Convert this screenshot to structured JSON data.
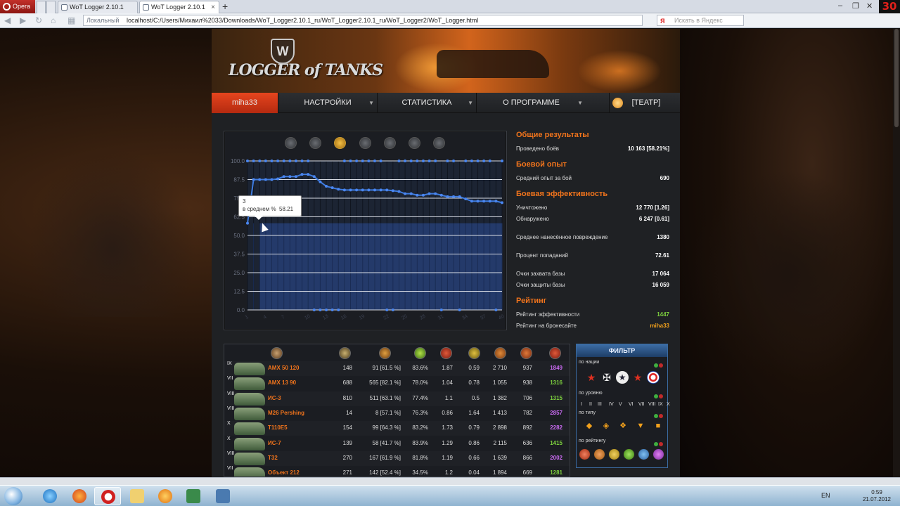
{
  "browser": {
    "menu_label": "Opera",
    "tabs": [
      {
        "label": "WoT Logger 2.10.1"
      },
      {
        "label": "WoT Logger 2.10.1"
      }
    ],
    "address_prefix": "Локальный",
    "address": "localhost/C:/Users/Михаил%2033/Downloads/WoT_Logger2.10.1_ru/WoT_Logger2.10.1_ru/WoT_Logger2/WoT_Logger.html",
    "search_placeholder": "Искать в Яндекс",
    "fps_badge": "30"
  },
  "app": {
    "logo_text": "LOGGER of TANKS",
    "logo_emblem": "W",
    "nav": [
      {
        "label": "miha33"
      },
      {
        "label": "НАСТРОЙКИ"
      },
      {
        "label": "СТАТИСТИКА"
      },
      {
        "label": "О ПРОГРАММЕ"
      },
      {
        "label": "[ТЕАТР]"
      }
    ]
  },
  "chart_data": {
    "type": "line",
    "ylim": [
      0,
      100
    ],
    "yticks": [
      "100.0",
      "87.5",
      "75.0",
      "62.5",
      "50.0",
      "37.5",
      "25.0",
      "12.5",
      "0.0"
    ],
    "xticks": [
      "1",
      "4",
      "7",
      "10",
      "13",
      "16",
      "19",
      "22",
      "25",
      "28",
      "31",
      "34",
      "37",
      "40"
    ],
    "series": [
      {
        "values": [
          58.2,
          87.5,
          87.5,
          87.5,
          87.5,
          88,
          89.5,
          89.5,
          89.5,
          91,
          91,
          89.5,
          86,
          83,
          82,
          81,
          80.5,
          80.5,
          80.5,
          80.5,
          80.5,
          80.5,
          80.5,
          80.5,
          80,
          79.5,
          78,
          78,
          77,
          77,
          78,
          78,
          77,
          76,
          76,
          76,
          74.5,
          73,
          73,
          73,
          73,
          73,
          72
        ]
      },
      {
        "values": [
          100,
          100,
          100,
          100,
          100,
          100,
          100,
          100,
          100,
          100,
          100,
          0,
          0,
          0,
          0,
          0,
          100,
          100,
          100,
          100,
          100,
          100,
          100,
          0,
          0,
          100,
          100,
          100,
          100,
          100,
          100,
          100,
          0,
          100,
          100,
          0,
          100,
          100,
          100,
          100,
          100,
          0,
          100
        ]
      }
    ],
    "tooltip": {
      "line1": "3",
      "label": "в среднем %",
      "value": "58.21"
    }
  },
  "stats": {
    "general": {
      "title": "Общие результаты",
      "rows": [
        {
          "label": "Проведено боёв",
          "value": "10 163 [58.21%]"
        }
      ]
    },
    "xp": {
      "title": "Боевой опыт",
      "rows": [
        {
          "label": "Средний опыт за бой",
          "value": "690"
        }
      ]
    },
    "efficiency": {
      "title": "Боевая эффективность",
      "rows": [
        {
          "label": "Уничтожено",
          "value": "12 770 [1.26]"
        },
        {
          "label": "Обнаружено",
          "value": "6 247 [0.61]"
        },
        {
          "label": "Среднее нанесённое повреждение",
          "value": "1380"
        },
        {
          "label": "Процент попаданий",
          "value": "72.61"
        },
        {
          "label": "Очки захвата базы",
          "value": "17 064"
        },
        {
          "label": "Очки защиты базы",
          "value": "16 059"
        }
      ]
    },
    "rating": {
      "title": "Рейтинг",
      "rows": [
        {
          "label": "Рейтинг эффективности",
          "value": "1447"
        },
        {
          "label": "Рейтинг на бронесайте",
          "value": "miha33"
        }
      ]
    }
  },
  "tanks": [
    {
      "tier": "IX",
      "name": "AMX 50 120",
      "battles": "148",
      "wins": "91 [61.5 %]",
      "acc": "83.6%",
      "kills": "1.87",
      "spot": "0.59",
      "dmg": "2 710",
      "xp": "937",
      "eff": "1849",
      "eff_color": "#c86af0"
    },
    {
      "tier": "VII",
      "name": "AMX 13 90",
      "battles": "688",
      "wins": "565 [82.1 %]",
      "acc": "78.0%",
      "kills": "1.04",
      "spot": "0.78",
      "dmg": "1 055",
      "xp": "938",
      "eff": "1316",
      "eff_color": "#7ed23e"
    },
    {
      "tier": "VIII",
      "name": "ИС-3",
      "battles": "810",
      "wins": "511 [63.1 %]",
      "acc": "77.4%",
      "kills": "1.1",
      "spot": "0.5",
      "dmg": "1 382",
      "xp": "706",
      "eff": "1315",
      "eff_color": "#7ed23e"
    },
    {
      "tier": "VIII",
      "name": "M26 Pershing",
      "battles": "14",
      "wins": "8 [57.1 %]",
      "acc": "76.3%",
      "kills": "0.86",
      "spot": "1.64",
      "dmg": "1 413",
      "xp": "782",
      "eff": "2857",
      "eff_color": "#c86af0"
    },
    {
      "tier": "X",
      "name": "T110E5",
      "battles": "154",
      "wins": "99 [64.3 %]",
      "acc": "83.2%",
      "kills": "1.73",
      "spot": "0.79",
      "dmg": "2 898",
      "xp": "892",
      "eff": "2282",
      "eff_color": "#c86af0"
    },
    {
      "tier": "X",
      "name": "ИС-7",
      "battles": "139",
      "wins": "58 [41.7 %]",
      "acc": "83.9%",
      "kills": "1.29",
      "spot": "0.86",
      "dmg": "2 115",
      "xp": "636",
      "eff": "1415",
      "eff_color": "#7ed23e"
    },
    {
      "tier": "VIII",
      "name": "T32",
      "battles": "270",
      "wins": "167 [61.9 %]",
      "acc": "81.8%",
      "kills": "1.19",
      "spot": "0.66",
      "dmg": "1 639",
      "xp": "866",
      "eff": "2002",
      "eff_color": "#c86af0"
    },
    {
      "tier": "VII",
      "name": "Объект 212",
      "battles": "271",
      "wins": "142 [52.4 %]",
      "acc": "34.5%",
      "kills": "1.2",
      "spot": "0.04",
      "dmg": "1 894",
      "xp": "669",
      "eff": "1281",
      "eff_color": "#7ed23e"
    }
  ],
  "filter": {
    "title": "ФИЛЬТР",
    "by_nation": "по нации",
    "by_level": "по уровню",
    "by_type": "по типу",
    "by_rating": "по рейтингу",
    "levels": [
      "I",
      "II",
      "III",
      "IV",
      "V",
      "VI",
      "VII",
      "VIII",
      "IX",
      "X"
    ]
  },
  "taskbar": {
    "lang": "EN",
    "time": "0:59",
    "date": "21.07.2012"
  }
}
